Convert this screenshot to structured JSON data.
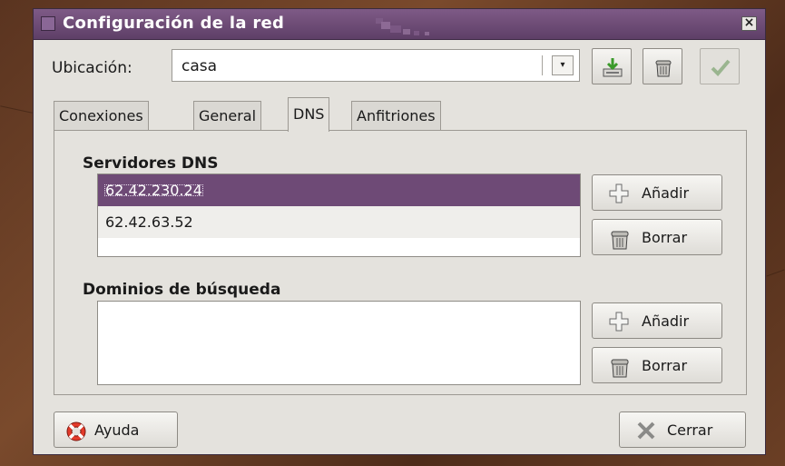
{
  "window": {
    "title": "Configuración de la red",
    "close_glyph": "×"
  },
  "location": {
    "label": "Ubicación:",
    "value": "casa"
  },
  "toolbar": {
    "icons": [
      "save-location-icon",
      "delete-location-icon",
      "apply-check-icon"
    ]
  },
  "tabs": [
    {
      "label": "Conexiones",
      "active": false
    },
    {
      "label": "General",
      "active": false
    },
    {
      "label": "DNS",
      "active": true
    },
    {
      "label": "Anfitriones",
      "active": false
    }
  ],
  "dns": {
    "title": "Servidores DNS",
    "servers": [
      "62.42.230.24",
      "62.42.63.52"
    ],
    "selected_index": 0,
    "add_label": "Añadir",
    "delete_label": "Borrar"
  },
  "domains": {
    "title": "Dominios de búsqueda",
    "items": [],
    "add_label": "Añadir",
    "delete_label": "Borrar"
  },
  "footer": {
    "help_label": "Ayuda",
    "close_label": "Cerrar"
  },
  "colors": {
    "titlebar": "#6a4a73",
    "selection": "#6e4a76",
    "window_bg": "#e4e2dd"
  }
}
